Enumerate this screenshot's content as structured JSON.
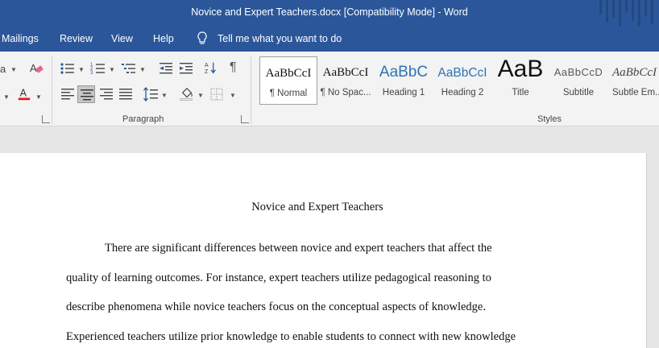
{
  "window": {
    "title": "Novice and Expert Teachers.docx [Compatibility Mode]  -  Word"
  },
  "tabs": [
    {
      "label": "Mailings"
    },
    {
      "label": "Review"
    },
    {
      "label": "View"
    },
    {
      "label": "Help"
    }
  ],
  "tell_me": {
    "placeholder": "Tell me what you want to do",
    "icon": "lightbulb-icon"
  },
  "font_group": {
    "partial_label": "a"
  },
  "paragraph_group": {
    "label": "Paragraph"
  },
  "styles_group": {
    "label": "Styles",
    "items": [
      {
        "sample": "AaBbCcI",
        "name": "¶ Normal",
        "selected": true
      },
      {
        "sample": "AaBbCcI",
        "name": "¶ No Spac..."
      },
      {
        "sample": "AaBbC",
        "name": "Heading 1"
      },
      {
        "sample": "AaBbCcI",
        "name": "Heading 2"
      },
      {
        "sample": "AaB",
        "name": "Title"
      },
      {
        "sample": "AaBbCcD",
        "name": "Subtitle"
      },
      {
        "sample": "AaBbCcI",
        "name": "Subtle Em..."
      }
    ]
  },
  "document": {
    "title": "Novice and Expert Teachers",
    "lines": [
      "There are significant differences between novice and expert teachers that affect the",
      "quality of learning outcomes. For instance, expert teachers utilize pedagogical reasoning to",
      "describe phenomena while novice teachers focus on the conceptual aspects of knowledge.",
      "Experienced teachers utilize prior knowledge to enable students to connect with new knowledge"
    ]
  },
  "colors": {
    "word_blue": "#2b579a",
    "font_color_red": "#e81123",
    "heading_blue": "#2e74b5"
  }
}
